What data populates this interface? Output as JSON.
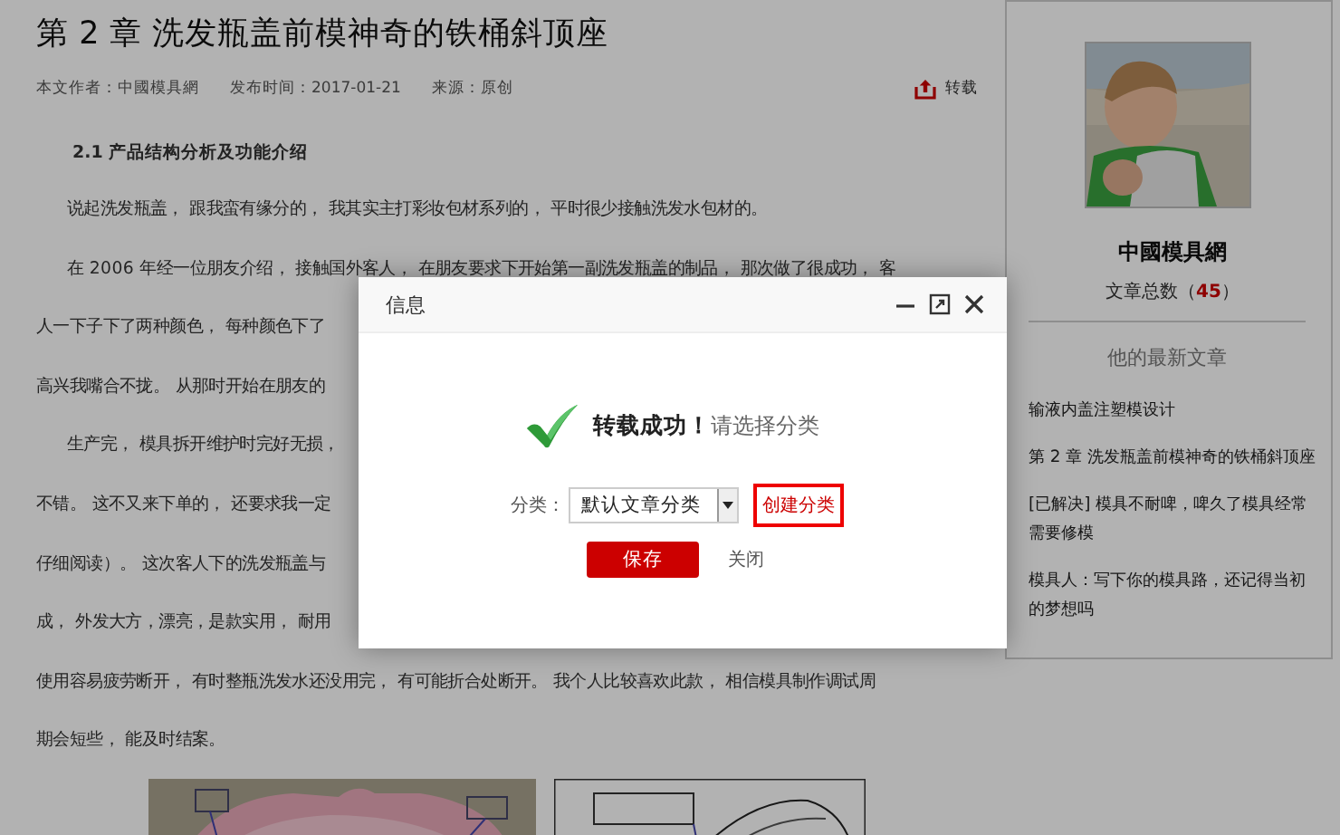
{
  "article": {
    "title": "第 2 章 洗发瓶盖前模神奇的铁桶斜顶座",
    "meta": [
      "本文作者：中國模具網",
      "发布时间：2017-01-21",
      "来源：原创"
    ],
    "share": {
      "label": "转载"
    },
    "section_heading": "2.1 产品结构分析及功能介绍",
    "lines": [
      {
        "kind": "first",
        "text": "说起洗发瓶盖， 跟我蛮有缘分的， 我其实主打彩妆包材系列的， 平时很少接触洗发水包材的。"
      },
      {
        "kind": "first",
        "text": "在 2006 年经一位朋友介绍， 接触国外客人， 在朋友要求下开始第一副洗发瓶盖的制品， 那次做了很成功， 客"
      },
      {
        "kind": "cont",
        "text": "人一下子下了两种颜色， 每种颜色下了"
      },
      {
        "kind": "cont",
        "text": "高兴我嘴合不拢。 从那时开始在朋友的"
      },
      {
        "kind": "first",
        "text": "生产完， 模具拆开维护时完好无损，"
      },
      {
        "kind": "cont",
        "text": "不错。 这不又来下单的， 还要求我一定"
      },
      {
        "kind": "cont",
        "text": "仔细阅读）。 这次客人下的洗发瓶盖与"
      },
      {
        "kind": "cont",
        "text": "成， 外发大方，漂亮，是款实用， 耐用"
      },
      {
        "kind": "cont",
        "text": "使用容易疲劳断开， 有时整瓶洗发水还没用完， 有可能折合处断开。 我个人比较喜欢此款， 相信模具制作调试周"
      },
      {
        "kind": "cont",
        "text": "期会短些， 能及时结案。"
      }
    ],
    "figures": [
      {
        "kind": "picture"
      },
      {
        "kind": "picture"
      }
    ]
  },
  "sidebar": {
    "avatar": {
      "kind": "picture"
    },
    "author_name": "中國模具網",
    "count_label": "文章总数（",
    "count": "45",
    "count_close": "）",
    "latest_heading": "他的最新文章",
    "latest_articles": [
      "输液内盖注塑模设计",
      "第 2 章 洗发瓶盖前模神奇的铁桶斜顶座",
      "[已解决] 模具不耐啤，啤久了模具经常需要修模",
      "模具人：写下你的模具路，还记得当初的梦想吗"
    ]
  },
  "dialog": {
    "title": "信息",
    "message_bold": "转载成功！",
    "message": "请选择分类",
    "field_label": "分类：",
    "category": "默认文章分类",
    "create_link": "创建分类",
    "save": "保存",
    "close": "关闭"
  }
}
